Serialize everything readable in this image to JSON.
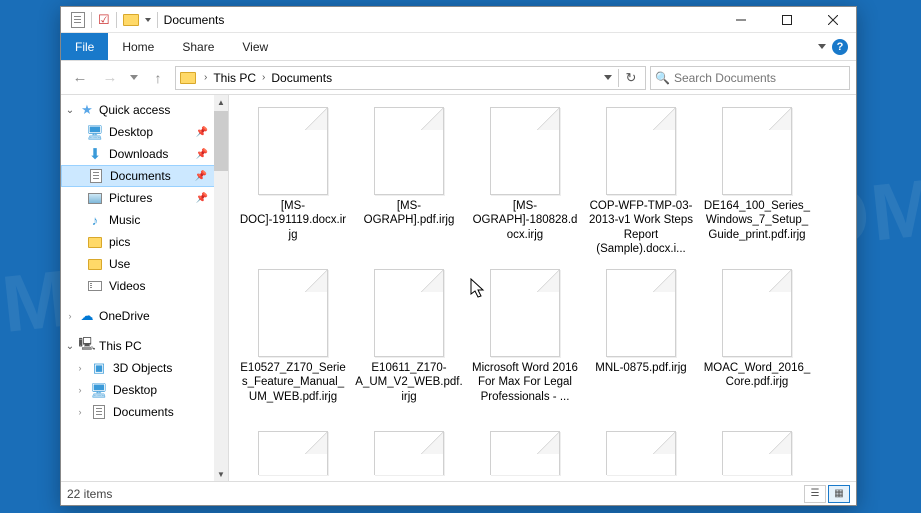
{
  "window": {
    "title": "Documents"
  },
  "ribbon": {
    "file": "File",
    "tabs": [
      "Home",
      "Share",
      "View"
    ]
  },
  "nav": {
    "breadcrumb": [
      "This PC",
      "Documents"
    ],
    "search_placeholder": "Search Documents"
  },
  "sidebar": {
    "quick_access": {
      "label": "Quick access"
    },
    "qa_items": [
      {
        "label": "Desktop",
        "pinned": true
      },
      {
        "label": "Downloads",
        "pinned": true
      },
      {
        "label": "Documents",
        "pinned": true,
        "selected": true
      },
      {
        "label": "Pictures",
        "pinned": true
      },
      {
        "label": "Music",
        "pinned": false
      },
      {
        "label": "pics",
        "pinned": false
      },
      {
        "label": "Use",
        "pinned": false
      },
      {
        "label": "Videos",
        "pinned": false
      }
    ],
    "onedrive": {
      "label": "OneDrive"
    },
    "thispc": {
      "label": "This PC"
    },
    "pc_items": [
      {
        "label": "3D Objects"
      },
      {
        "label": "Desktop"
      },
      {
        "label": "Documents"
      }
    ]
  },
  "files": [
    {
      "name": "[MS-DOC]-191119.docx.irjg"
    },
    {
      "name": "[MS-OGRAPH].pdf.irjg"
    },
    {
      "name": "[MS-OGRAPH]-180828.docx.irjg"
    },
    {
      "name": "COP-WFP-TMP-03-2013-v1 Work Steps Report (Sample).docx.i..."
    },
    {
      "name": "DE164_100_Series_Windows_7_Setup_Guide_print.pdf.irjg"
    },
    {
      "name": "E10527_Z170_Series_Feature_Manual_UM_WEB.pdf.irjg"
    },
    {
      "name": "E10611_Z170-A_UM_V2_WEB.pdf.irjg"
    },
    {
      "name": "Microsoft Word 2016 For Max For Legal Professionals - ..."
    },
    {
      "name": "MNL-0875.pdf.irjg"
    },
    {
      "name": "MOAC_Word_2016_Core.pdf.irjg"
    }
  ],
  "files_partial_row_count": 5,
  "statusbar": {
    "items_text": "22 items"
  },
  "watermark": "MYANTISPYWARE.COM"
}
